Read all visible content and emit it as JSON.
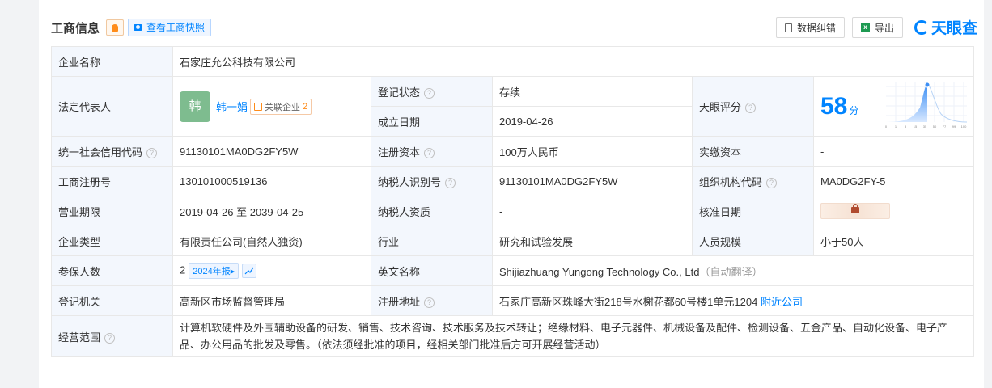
{
  "header": {
    "title": "工商信息",
    "snapshot_button": "查看工商快照",
    "correct_button": "数据纠错",
    "export_button": "导出",
    "logo_text": "天眼查",
    "brand_color": "#0084ff"
  },
  "rows": {
    "company_name": {
      "label": "企业名称",
      "value": "石家庄允公科技有限公司"
    },
    "legal_rep": {
      "label": "法定代表人",
      "avatar": "韩",
      "name": "韩一娟",
      "related_label": "关联企业",
      "related_count": "2"
    },
    "reg_status": {
      "label": "登记状态",
      "value": "存续"
    },
    "founded": {
      "label": "成立日期",
      "value": "2019-04-26"
    },
    "score": {
      "label": "天眼评分",
      "value": "58",
      "unit": "分",
      "axis": [
        "0",
        "1",
        "3",
        "15",
        "35",
        "50",
        "77",
        "99",
        "100"
      ]
    },
    "credit_code": {
      "label": "统一社会信用代码",
      "value": "91130101MA0DG2FY5W"
    },
    "reg_capital": {
      "label": "注册资本",
      "value": "100万人民币"
    },
    "paid_capital": {
      "label": "实缴资本",
      "value": "-"
    },
    "reg_no": {
      "label": "工商注册号",
      "value": "130101000519136"
    },
    "taxpayer_id": {
      "label": "纳税人识别号",
      "value": "91130101MA0DG2FY5W"
    },
    "org_code": {
      "label": "组织机构代码",
      "value": "MA0DG2FY-5"
    },
    "term": {
      "label": "营业期限",
      "value": "2019-04-26 至 2039-04-25"
    },
    "taxpayer_qual": {
      "label": "纳税人资质",
      "value": "-"
    },
    "approval_date": {
      "label": "核准日期"
    },
    "company_type": {
      "label": "企业类型",
      "value": "有限责任公司(自然人独资)"
    },
    "industry": {
      "label": "行业",
      "value": "研究和试验发展"
    },
    "staff_size": {
      "label": "人员规模",
      "value": "小于50人"
    },
    "insured": {
      "label": "参保人数",
      "value": "2",
      "year_tag": "2024年报▸"
    },
    "english_name": {
      "label": "英文名称",
      "value": "Shijiazhuang Yungong Technology Co., Ltd",
      "note": "（自动翻译）"
    },
    "reg_authority": {
      "label": "登记机关",
      "value": "高新区市场监督管理局"
    },
    "reg_address": {
      "label": "注册地址",
      "value": "石家庄高新区珠峰大街218号水榭花都60号楼1单元1204",
      "link": "附近公司"
    },
    "business_scope": {
      "label": "经营范围",
      "value": "计算机软硬件及外围辅助设备的研发、销售、技术咨询、技术服务及技术转让；绝缘材料、电子元器件、机械设备及配件、检测设备、五金产品、自动化设备、电子产品、办公用品的批发及零售。（依法须经批准的项目，经相关部门批准后方可开展经营活动）"
    }
  }
}
